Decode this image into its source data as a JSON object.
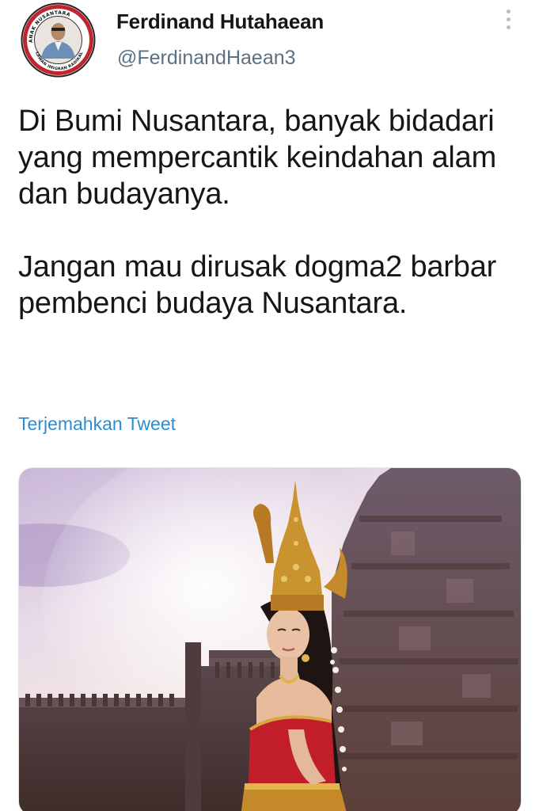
{
  "tweet": {
    "author_name": "Ferdinand Hutahaean",
    "author_handle": "@FerdinandHaean3",
    "text_paragraphs": [
      "Di Bumi Nusantara, banyak bidadari yang mempercantik keindahan alam dan budayanya.",
      "Jangan mau dirusak dogma2 barbar pembenci budaya Nusantara."
    ],
    "translate_label": "Terjemahkan Tweet"
  },
  "avatar": {
    "badge_text": "ANAK NUSANTARA",
    "badge_subtext": "LAWAN IMIGRAN RADIKAL"
  },
  "icons": {
    "more": "more-vertical-icon"
  },
  "colors": {
    "link_blue": "#2f8ccf",
    "secondary_text": "#5b7083",
    "primary_text": "#14171a"
  }
}
